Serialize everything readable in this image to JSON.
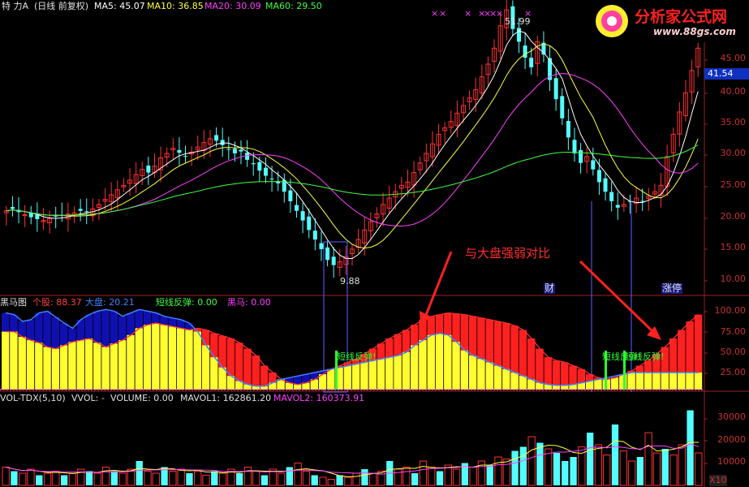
{
  "header": {
    "stock_name": "特 力A",
    "period": "(日线 前复权)",
    "ma": [
      {
        "label": "MA5: ",
        "value": "45.07",
        "color": "#ffffff"
      },
      {
        "label": "MA10: ",
        "value": "36.85",
        "color": "#ffff40"
      },
      {
        "label": "MA20: ",
        "value": "30.09",
        "color": "#ff40ff"
      },
      {
        "label": "MA60: ",
        "value": "29.50",
        "color": "#40ff40"
      }
    ]
  },
  "logo": {
    "name": "分析家公式网",
    "url": "www.88gs.com"
  },
  "price_panel": {
    "current_price_tag": "41.54",
    "high_label": "51.99",
    "low_label": "9.88",
    "y_ticks": [
      "45.00",
      "40.00",
      "35.00",
      "30.00",
      "25.00",
      "20.00",
      "15.00",
      "10.00"
    ],
    "markers": [
      "财",
      "涨停"
    ],
    "x_marks": [
      "×",
      "×",
      "×",
      "×",
      "×",
      "×",
      "×",
      "×"
    ]
  },
  "indicator_panel": {
    "title": "黑马图",
    "items": [
      {
        "label": "个股: ",
        "value": "88.37",
        "color": "#ff4040"
      },
      {
        "label": "大盘: ",
        "value": "20.21",
        "color": "#4080ff"
      },
      {
        "label": "短线反弹: ",
        "value": "0.00",
        "color": "#40ff40"
      },
      {
        "label": "黑马: ",
        "value": "0.00",
        "color": "#ff40ff"
      }
    ],
    "y_ticks": [
      "100.00",
      "75.00",
      "50.00",
      "25.00"
    ],
    "rebound_label": "短线反弹!",
    "annotation": "与大盘强弱对比"
  },
  "volume_panel": {
    "title": "VOL-TDX(5,10)",
    "items": [
      {
        "label": "VVOL: ",
        "value": "-",
        "color": "#e0e0e0"
      },
      {
        "label": "VOLUME: ",
        "value": "0.00",
        "color": "#e0e0e0"
      },
      {
        "label": "MAVOL1: ",
        "value": "162861.20",
        "color": "#e0e0e0"
      },
      {
        "label": "MAVOL2: ",
        "value": "160373.91",
        "color": "#ff40ff"
      }
    ],
    "y_ticks": [
      "30000",
      "20000",
      "10000"
    ],
    "unit": "X10"
  },
  "chart_data": [
    {
      "type": "candlestick",
      "title": "特 力A (日线 前复权)",
      "ylim": [
        7,
        50
      ],
      "grid": false,
      "series": [
        {
          "name": "K",
          "values": [
            19.5,
            19.8,
            19.3,
            18.9,
            18.5,
            18.2,
            18.0,
            18.3,
            18.6,
            18.8,
            19.0,
            19.2,
            19.5,
            19.3,
            19.8,
            20.5,
            21.3,
            22.0,
            22.8,
            23.5,
            24.3,
            25.2,
            26.0,
            25.5,
            26.5,
            27.8,
            28.5,
            29.3,
            28.6,
            28.0,
            28.7,
            29.5,
            30.2,
            30.8,
            30.5,
            29.8,
            29.2,
            28.5,
            28.8,
            27.5,
            26.8,
            25.8,
            25.0,
            24.5,
            23.8,
            22.5,
            21.0,
            19.5,
            18.0,
            16.5,
            15.0,
            13.5,
            11.8,
            11.0,
            11.5,
            12.3,
            13.5,
            15.0,
            16.5,
            17.8,
            19.0,
            20.5,
            21.5,
            22.5,
            23.5,
            24.0,
            25.5,
            27.0,
            28.5,
            30.0,
            31.5,
            32.5,
            33.5,
            34.8,
            36.0,
            37.2,
            38.5,
            40.5,
            42.5,
            45.0,
            48.5,
            51.0,
            48.0,
            46.0,
            43.5,
            42.0,
            46.0,
            44.0,
            40.0,
            37.0,
            34.0,
            31.0,
            28.5,
            27.0,
            28.0,
            26.0,
            24.0,
            22.5,
            21.0,
            20.0,
            20.5,
            21.0,
            21.5,
            21.0,
            21.8,
            22.5,
            23.5,
            28.0,
            31.5,
            35.0,
            38.0,
            41.5,
            45.0
          ]
        },
        {
          "name": "MA5",
          "values": [
            45.07
          ]
        },
        {
          "name": "MA10",
          "values": [
            36.85
          ]
        },
        {
          "name": "MA20",
          "values": [
            30.09
          ]
        },
        {
          "name": "MA60",
          "values": [
            29.5
          ]
        }
      ],
      "annotations": [
        "51.99",
        "9.88"
      ]
    },
    {
      "type": "bar",
      "title": "黑马图",
      "ylim": [
        0,
        100
      ],
      "series": [
        {
          "name": "个股",
          "values": [
            68,
            68,
            62,
            58,
            55,
            50,
            48,
            52,
            56,
            58,
            60,
            55,
            50,
            54,
            58,
            64,
            72,
            76,
            78,
            76,
            74,
            72,
            70,
            72,
            70,
            66,
            63,
            60,
            55,
            48,
            40,
            28,
            20,
            12,
            8,
            6,
            8,
            12,
            18,
            24,
            28,
            32,
            36,
            42,
            48,
            54,
            60,
            65,
            70,
            76,
            82,
            86,
            88,
            90,
            89,
            88,
            86,
            84,
            82,
            80,
            78,
            75,
            70,
            60,
            48,
            38,
            34,
            32,
            28,
            24,
            18,
            14,
            12,
            14,
            18,
            22,
            28,
            34,
            42,
            50,
            60,
            70,
            80,
            88
          ]
        },
        {
          "name": "大盘",
          "values": [
            90,
            88,
            80,
            82,
            90,
            92,
            85,
            78,
            72,
            82,
            88,
            92,
            94,
            92,
            86,
            90,
            94,
            92,
            90,
            86,
            84,
            82,
            78,
            68,
            52,
            38,
            26,
            16,
            10,
            6,
            4,
            4,
            8,
            12,
            14,
            16,
            18,
            20,
            22,
            24,
            26,
            28,
            30,
            32,
            34,
            36,
            38,
            40,
            44,
            52,
            58,
            64,
            66,
            64,
            56,
            46,
            40,
            36,
            32,
            28,
            24,
            20,
            16,
            12,
            8,
            6,
            5,
            5,
            6,
            8,
            10,
            12,
            14,
            16,
            18,
            20,
            20,
            20,
            20,
            20,
            20,
            20,
            20,
            20
          ]
        }
      ]
    },
    {
      "type": "bar",
      "title": "VOL-TDX(5,10)",
      "ylim": [
        0,
        40000
      ],
      "series": [
        {
          "name": "VOLUME",
          "values": [
            9000,
            7000,
            6000,
            8000,
            5000,
            6000,
            7000,
            5000,
            6000,
            8000,
            7000,
            6000,
            9000,
            7000,
            6000,
            8000,
            12000,
            7000,
            6000,
            9000,
            7000,
            8000,
            6000,
            7000,
            5000,
            7000,
            6000,
            8000,
            6000,
            9000,
            7000,
            5000,
            8000,
            6000,
            9000,
            11000,
            7000,
            5000,
            4000,
            3000,
            5000,
            4000,
            6000,
            8000,
            6000,
            7000,
            12000,
            8000,
            9000,
            6000,
            12000,
            9000,
            7000,
            10000,
            8000,
            11000,
            9000,
            12000,
            10000,
            14000,
            13000,
            17000,
            19000,
            24000,
            21000,
            18000,
            16000,
            12000,
            14000,
            19000,
            26000,
            20000,
            15000,
            30000,
            17000,
            12000,
            14000,
            26000,
            16000,
            18000,
            15000,
            20000,
            37000,
            16000
          ]
        },
        {
          "name": "MAVOL1",
          "values": [
            162861.2
          ]
        },
        {
          "name": "MAVOL2",
          "values": [
            160373.91
          ]
        }
      ]
    }
  ]
}
